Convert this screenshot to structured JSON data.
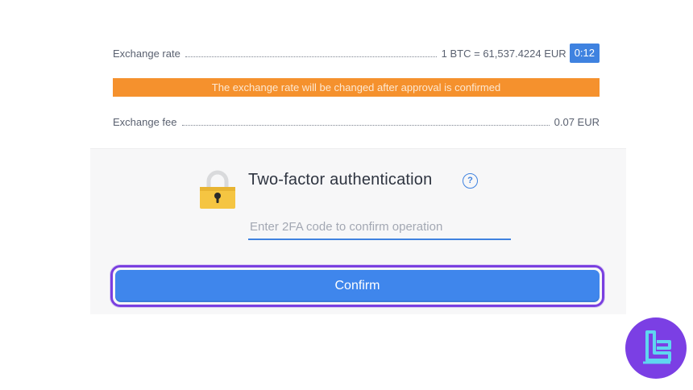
{
  "exchange": {
    "rate_label": "Exchange rate",
    "rate_value": "1 BTC = 61,537.4224 EUR",
    "timer": "0:12",
    "notice": "The exchange rate will be changed after approval is confirmed",
    "fee_label": "Exchange fee",
    "fee_value": "0.07 EUR"
  },
  "two_factor": {
    "title": "Two-factor authentication",
    "help_glyph": "?",
    "input_placeholder": "Enter 2FA code to confirm operation",
    "input_value": ""
  },
  "actions": {
    "confirm_label": "Confirm"
  },
  "icons": {
    "lock": "lock-icon",
    "help": "question-circle-icon",
    "brand": "brand-logo"
  },
  "colors": {
    "accent_blue": "#3f82e0",
    "notice_orange": "#f5912d",
    "highlight_purple": "#7a3fe0",
    "lock_yellow": "#f5c542"
  }
}
